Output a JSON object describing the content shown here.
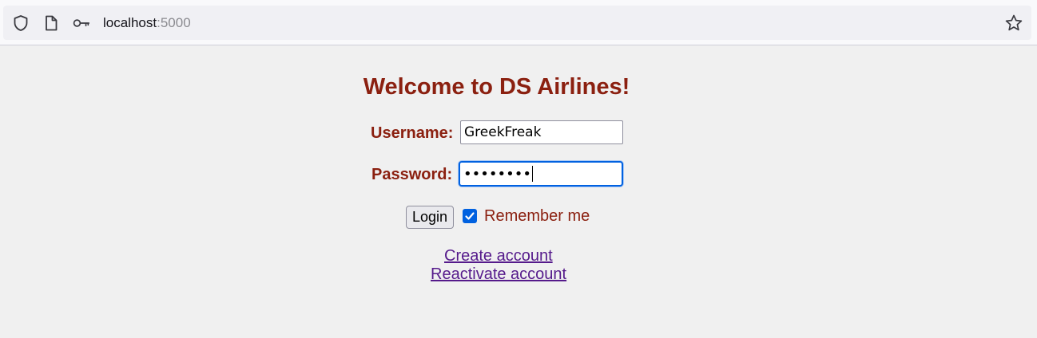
{
  "browser": {
    "url_host": "localhost",
    "url_port": ":5000",
    "icons": [
      "shield-icon",
      "page-icon",
      "key-icon",
      "star-icon"
    ]
  },
  "page": {
    "title": "Welcome to DS Airlines!",
    "username_label": "Username:",
    "username_value": "GreekFreak",
    "password_label": "Password:",
    "password_masked": "••••••••",
    "login_label": "Login",
    "remember_checked": true,
    "remember_label": "Remember me",
    "create_account_link": "Create account",
    "reactivate_account_link": "Reactivate account"
  },
  "colors": {
    "brand_text": "#8b2010",
    "link": "#551a8b",
    "focus": "#0061e0"
  }
}
